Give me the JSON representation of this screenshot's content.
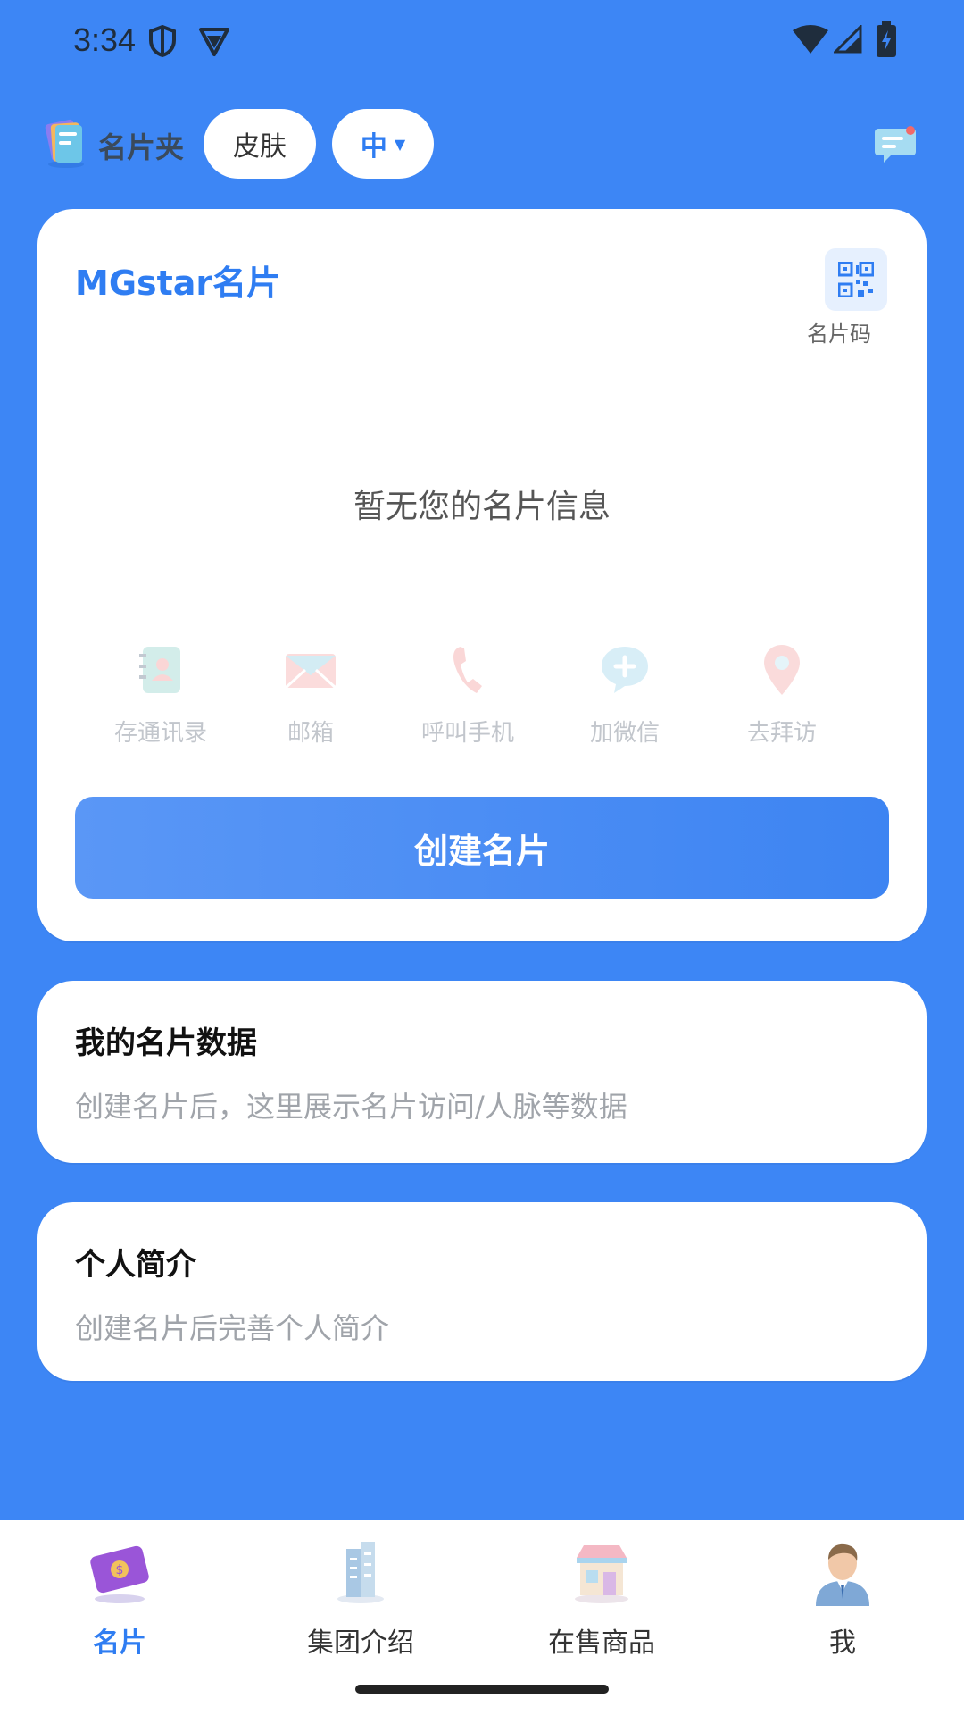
{
  "status_bar": {
    "time": "3:34"
  },
  "header": {
    "folder_label": "名片夹",
    "skin_label": "皮肤",
    "lang_label": "中"
  },
  "main_card": {
    "brand_title": "MGstar名片",
    "qr_label": "名片码",
    "empty_text": "暂无您的名片信息",
    "actions": [
      {
        "label": "存通讯录",
        "icon": "address-book-icon"
      },
      {
        "label": "邮箱",
        "icon": "envelope-icon"
      },
      {
        "label": "呼叫手机",
        "icon": "phone-icon"
      },
      {
        "label": "加微信",
        "icon": "chat-plus-icon"
      },
      {
        "label": "去拜访",
        "icon": "location-pin-icon"
      }
    ],
    "create_button": "创建名片"
  },
  "data_card": {
    "title": "我的名片数据",
    "subtitle": "创建名片后，这里展示名片访问/人脉等数据"
  },
  "intro_card": {
    "title": "个人简介",
    "subtitle": "创建名片后完善个人简介"
  },
  "bottom_nav": {
    "items": [
      {
        "label": "名片",
        "icon": "card-icon",
        "active": true
      },
      {
        "label": "集团介绍",
        "icon": "building-icon",
        "active": false
      },
      {
        "label": "在售商品",
        "icon": "store-icon",
        "active": false
      },
      {
        "label": "我",
        "icon": "avatar-icon",
        "active": false
      }
    ]
  },
  "colors": {
    "background": "#3d86f5",
    "accent": "#2f7df2",
    "card": "#ffffff"
  }
}
